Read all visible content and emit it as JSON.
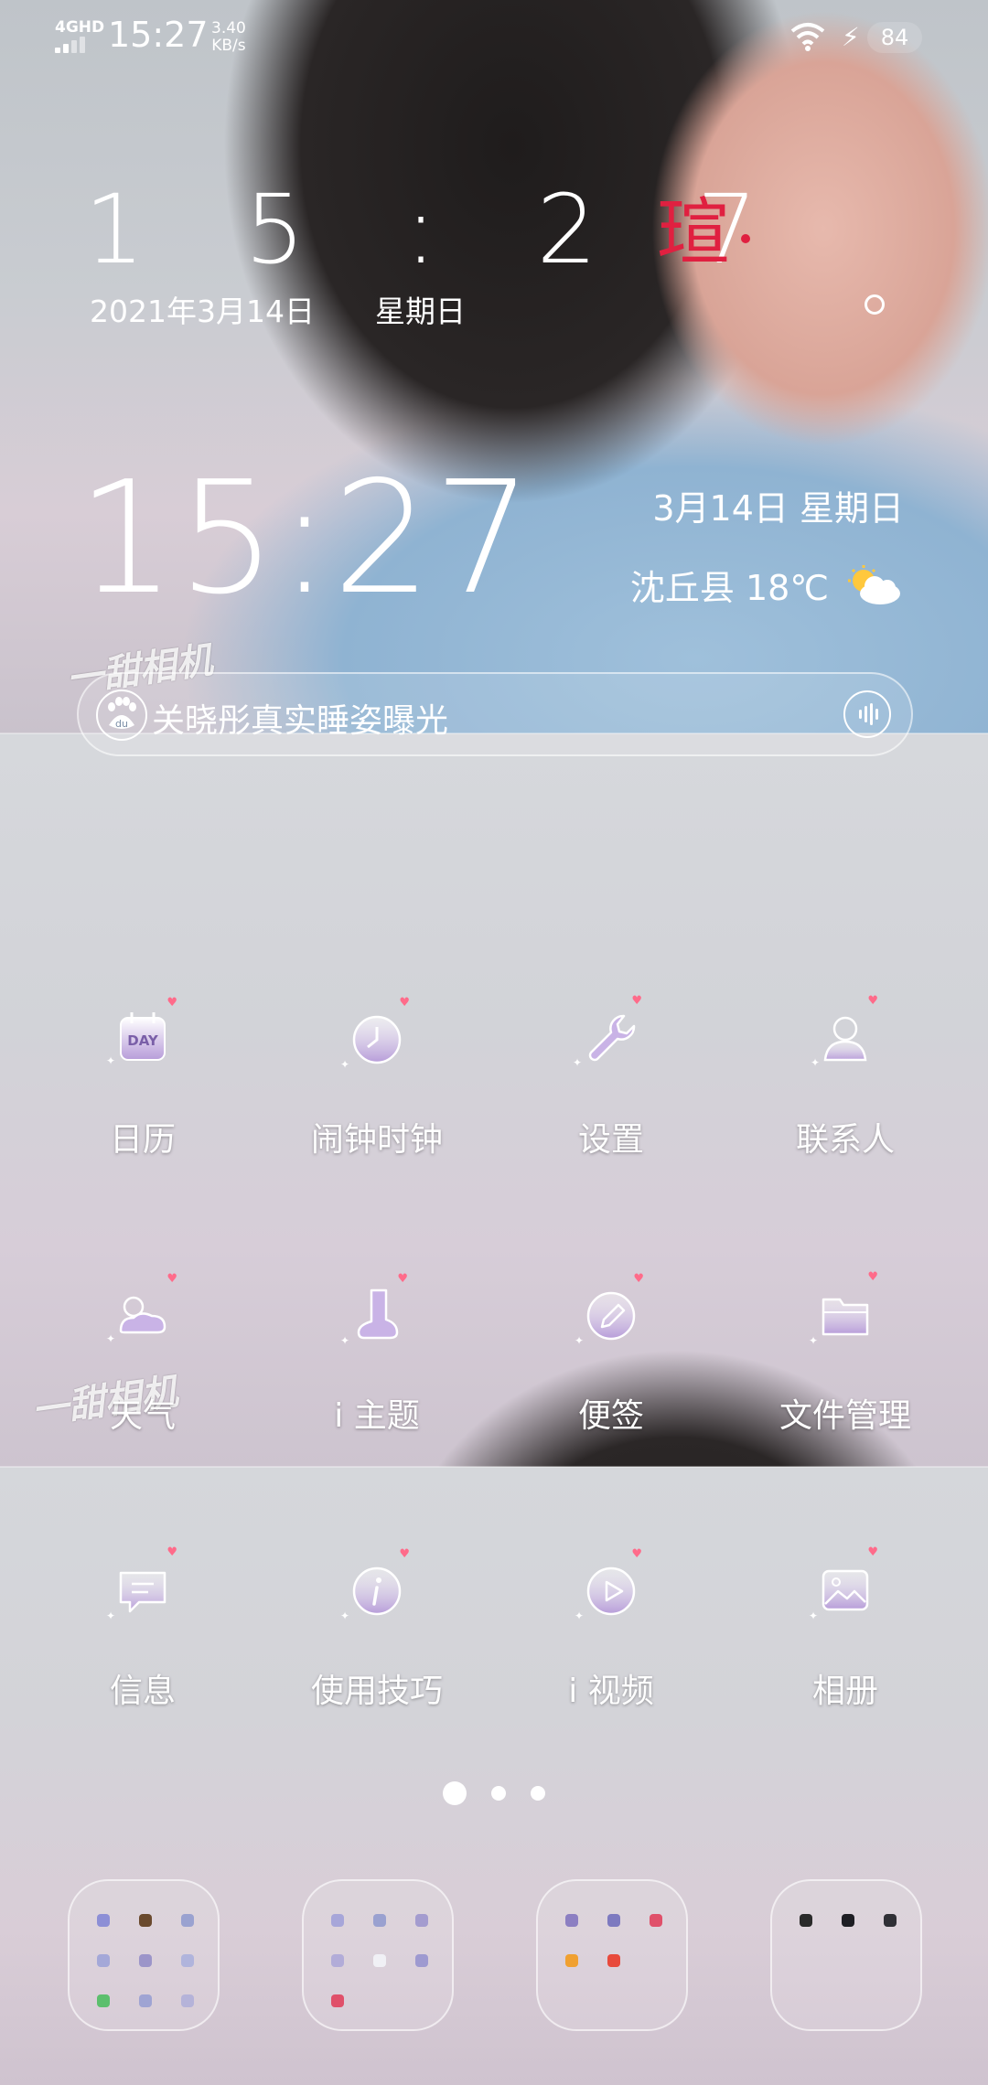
{
  "status_bar": {
    "network": "4GHD",
    "time": "15:27",
    "speed_value": "3.40",
    "speed_unit": "KB/s",
    "battery": "84"
  },
  "clock_widget": {
    "time_spaced": "1 5 : 2 7",
    "date": "2021年3月14日",
    "weekday": "星期日",
    "brand_char": "瑄"
  },
  "weather_widget": {
    "time": "15:27",
    "date": "3月14日 星期日",
    "location_temp": "沈丘县 18℃",
    "weather_icon": "partly-cloudy-icon"
  },
  "search": {
    "text": "关晓彤真实睡姿曝光",
    "logo": "baidu-paw-icon",
    "voice": "voice-icon"
  },
  "watermark": "一甜相机",
  "apps": [
    {
      "label": "日历",
      "icon": "calendar-icon"
    },
    {
      "label": "闹钟时钟",
      "icon": "clock-icon"
    },
    {
      "label": "设置",
      "icon": "wrench-icon"
    },
    {
      "label": "联系人",
      "icon": "contact-icon"
    },
    {
      "label": "天气",
      "icon": "weather-icon"
    },
    {
      "label": "i 主题",
      "icon": "theme-icon"
    },
    {
      "label": "便签",
      "icon": "pencil-icon"
    },
    {
      "label": "文件管理",
      "icon": "folder-icon"
    },
    {
      "label": "信息",
      "icon": "message-icon"
    },
    {
      "label": "使用技巧",
      "icon": "info-icon"
    },
    {
      "label": "i 视频",
      "icon": "video-icon"
    },
    {
      "label": "相册",
      "icon": "gallery-icon"
    }
  ],
  "page_indicator": {
    "pages": 3,
    "current": 1
  },
  "dock": [
    "folder-1",
    "folder-2",
    "folder-3",
    "folder-4"
  ],
  "colors": {
    "accent_red": "#e02040",
    "heart_pink": "#ff6b8a",
    "icon_purple": "#b79cd9"
  }
}
